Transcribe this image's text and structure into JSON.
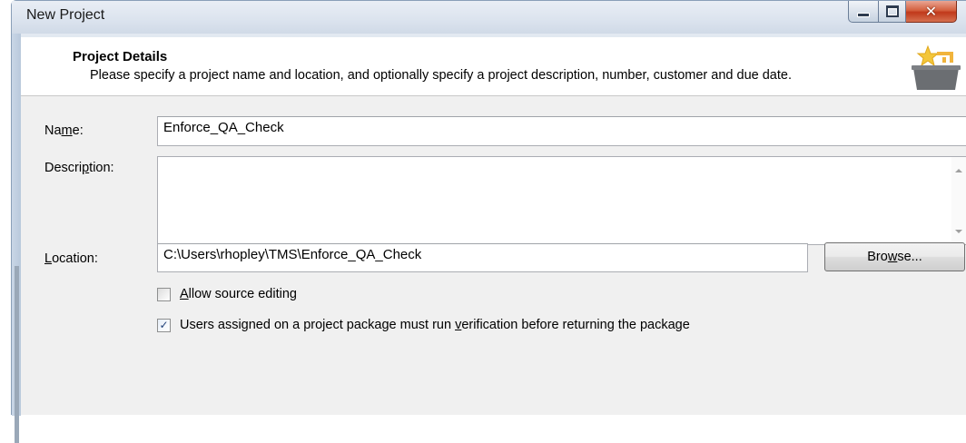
{
  "window": {
    "title": "New Project",
    "close_glyph": "✕"
  },
  "header": {
    "title": "Project Details",
    "description": "Please specify a project name and location, and optionally specify a project description, number, customer and due date."
  },
  "form": {
    "name": {
      "label_pre": "Na",
      "label_ul": "m",
      "label_post": "e:",
      "value": "Enforce_QA_Check"
    },
    "description": {
      "label_pre": "Descri",
      "label_ul": "p",
      "label_post": "tion:",
      "value": ""
    },
    "location": {
      "label_pre": "",
      "label_ul": "L",
      "label_post": "ocation:",
      "value": "C:\\Users\\rhopley\\TMS\\Enforce_QA_Check"
    },
    "browse_button": {
      "label_pre": "Bro",
      "label_ul": "w",
      "label_post": "se..."
    },
    "allow_source_editing": {
      "label_pre": "",
      "label_ul": "A",
      "label_post": "llow source editing",
      "checked": false
    },
    "verification": {
      "label_pre": "Users assigned on a project package must run ",
      "label_ul": "v",
      "label_post": "erification before returning the package",
      "checked": true,
      "check_glyph": "✓"
    }
  },
  "colors": {
    "close_button": "#c0391b",
    "title_bg": "#dbe3ee",
    "body_bg": "#f0f0f0"
  },
  "icons": {
    "header": "star-basket-icon"
  }
}
